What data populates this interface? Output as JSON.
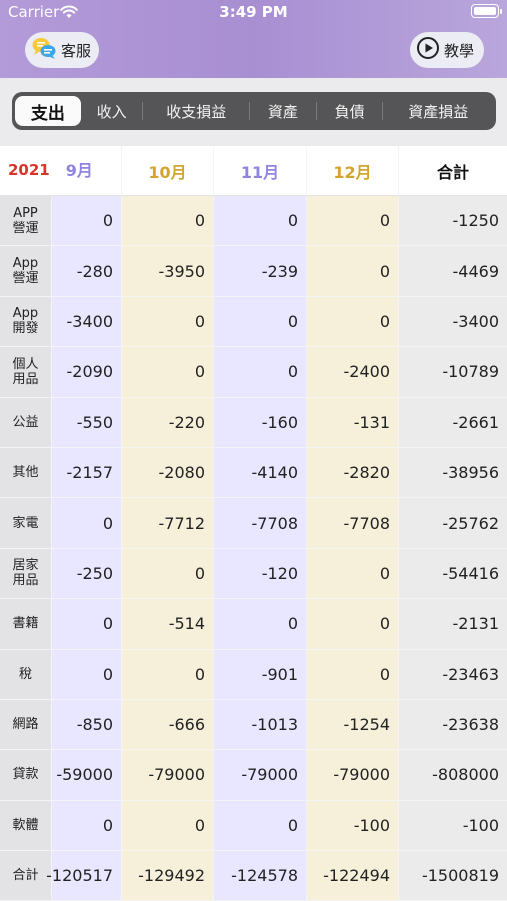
{
  "status_bar": {
    "carrier": "Carrier",
    "time": "3:49 PM"
  },
  "header": {
    "service_label": "客服",
    "tutorial_label": "教學"
  },
  "tabs": [
    {
      "label": "支出",
      "active": true
    },
    {
      "label": "收入",
      "active": false
    },
    {
      "label": "收支損益",
      "active": false
    },
    {
      "label": "資產",
      "active": false
    },
    {
      "label": "負債",
      "active": false
    },
    {
      "label": "資產損益",
      "active": false
    }
  ],
  "table": {
    "year": "2021",
    "columns": [
      "9月",
      "10月",
      "11月",
      "12月",
      "合計"
    ],
    "rows": [
      {
        "category": "APP\n營運",
        "values": [
          "0",
          "0",
          "0",
          "0",
          "-1250"
        ]
      },
      {
        "category": "App\n營運",
        "values": [
          "-280",
          "-3950",
          "-239",
          "0",
          "-4469"
        ]
      },
      {
        "category": "App\n開發",
        "values": [
          "-3400",
          "0",
          "0",
          "0",
          "-3400"
        ]
      },
      {
        "category": "個人\n用品",
        "values": [
          "-2090",
          "0",
          "0",
          "-2400",
          "-10789"
        ]
      },
      {
        "category": "公益",
        "values": [
          "-550",
          "-220",
          "-160",
          "-131",
          "-2661"
        ]
      },
      {
        "category": "其他",
        "values": [
          "-2157",
          "-2080",
          "-4140",
          "-2820",
          "-38956"
        ]
      },
      {
        "category": "家電",
        "values": [
          "0",
          "-7712",
          "-7708",
          "-7708",
          "-25762"
        ]
      },
      {
        "category": "居家\n用品",
        "values": [
          "-250",
          "0",
          "-120",
          "0",
          "-54416"
        ]
      },
      {
        "category": "書籍",
        "values": [
          "0",
          "-514",
          "0",
          "0",
          "-2131"
        ]
      },
      {
        "category": "稅",
        "values": [
          "0",
          "0",
          "-901",
          "0",
          "-23463"
        ]
      },
      {
        "category": "網路",
        "values": [
          "-850",
          "-666",
          "-1013",
          "-1254",
          "-23638"
        ]
      },
      {
        "category": "貸款",
        "values": [
          "-59000",
          "-79000",
          "-79000",
          "-79000",
          "-808000"
        ]
      },
      {
        "category": "軟體",
        "values": [
          "0",
          "0",
          "0",
          "-100",
          "-100"
        ]
      },
      {
        "category": "合計",
        "values": [
          "-120517",
          "-129492",
          "-124578",
          "-122494",
          "-1500819"
        ]
      }
    ]
  },
  "colors": {
    "header_gradient": "#a88fd2",
    "year": "#d8352a",
    "month_purple": "#8f84e0",
    "month_gold": "#d3a42e",
    "col_purple_bg": "#e9e6ff",
    "col_gold_bg": "#f6f0da"
  }
}
